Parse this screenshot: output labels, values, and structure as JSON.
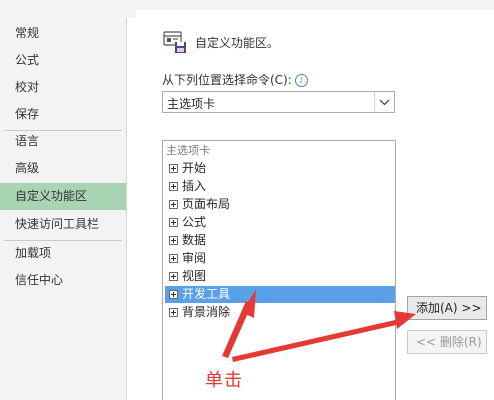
{
  "sidebar": {
    "items": [
      {
        "label": "常规",
        "selected": false
      },
      {
        "label": "公式",
        "selected": false
      },
      {
        "label": "校对",
        "selected": false
      },
      {
        "label": "保存",
        "selected": false
      },
      {
        "label": "语言",
        "selected": false
      },
      {
        "label": "高级",
        "selected": false
      },
      {
        "label": "自定义功能区",
        "selected": true
      },
      {
        "label": "快速访问工具栏",
        "selected": false
      },
      {
        "label": "加载项",
        "selected": false
      },
      {
        "label": "信任中心",
        "selected": false
      }
    ]
  },
  "section": {
    "title": "自定义功能区。",
    "icon": "customize-ribbon-icon"
  },
  "commands": {
    "label": "从下列位置选择命令(C):",
    "selected": "主选项卡",
    "tree_header": "主选项卡",
    "items": [
      {
        "label": "开始"
      },
      {
        "label": "插入"
      },
      {
        "label": "页面布局"
      },
      {
        "label": "公式"
      },
      {
        "label": "数据"
      },
      {
        "label": "审阅"
      },
      {
        "label": "视图"
      },
      {
        "label": "开发工具"
      },
      {
        "label": "背景消除"
      }
    ],
    "highlighted": "开发工具"
  },
  "buttons": {
    "add": "添加(A) >>",
    "remove": "<< 删除(R)"
  },
  "annotation": {
    "text": "单击",
    "color": "#e53935"
  },
  "colors": {
    "selected_sidebar": "#a9d4b3",
    "highlight_row": "#5aa0e8"
  }
}
